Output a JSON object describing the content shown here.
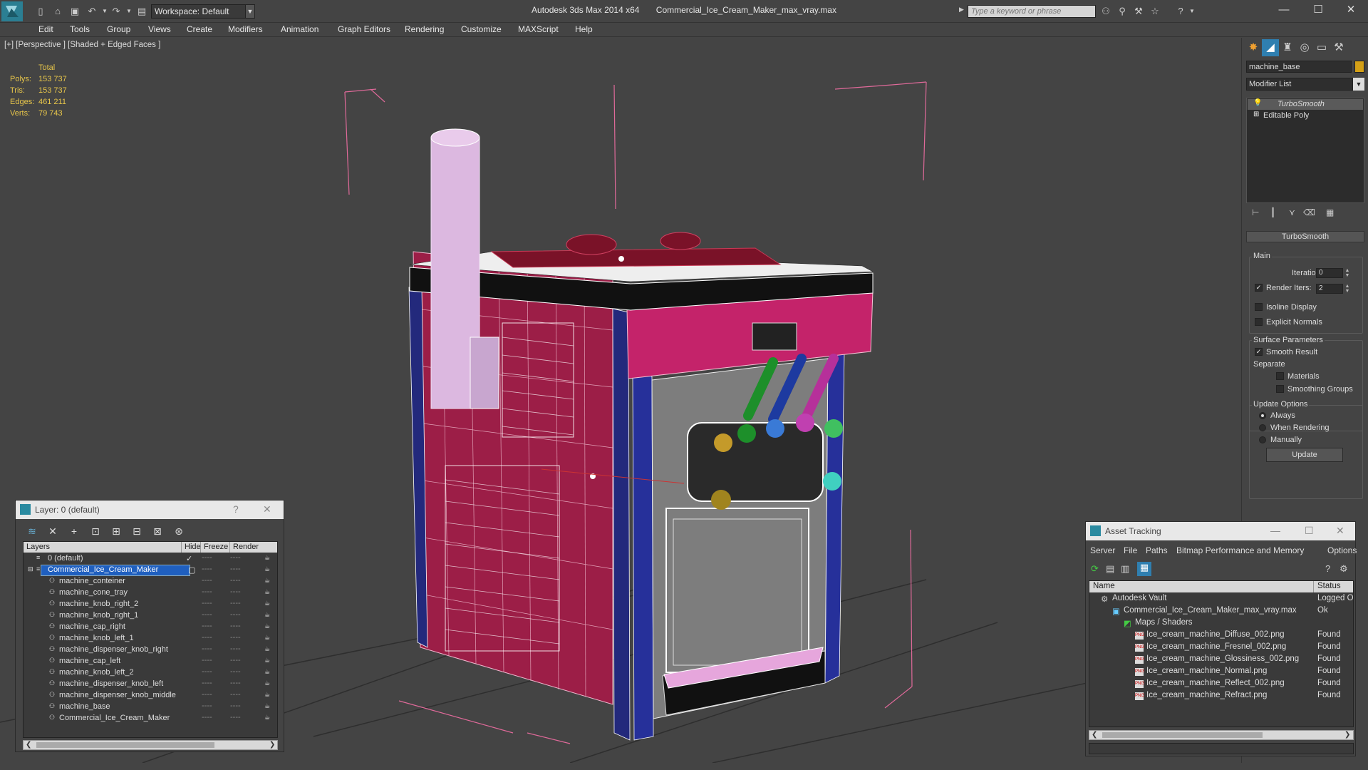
{
  "title": {
    "app": "Autodesk 3ds Max  2014 x64",
    "file": "Commercial_Ice_Cream_Maker_max_vray.max"
  },
  "workspace": "Workspace: Default",
  "search": {
    "placeholder": "Type a keyword or phrase"
  },
  "menu": [
    "Edit",
    "Tools",
    "Group",
    "Views",
    "Create",
    "Modifiers",
    "Animation",
    "Graph Editors",
    "Rendering",
    "Customize",
    "MAXScript",
    "Help"
  ],
  "viewport": {
    "label": "[+] [Perspective ] [Shaded + Edged Faces ]",
    "stats": {
      "header": "Total",
      "polys_label": "Polys:",
      "polys": "153 737",
      "tris_label": "Tris:",
      "tris": "153 737",
      "edges_label": "Edges:",
      "edges": "461 211",
      "verts_label": "Verts:",
      "verts": "79 743"
    }
  },
  "command_panel": {
    "object_name": "machine_base",
    "modifier_list": "Modifier List",
    "stack": [
      "TurboSmooth",
      "Editable Poly"
    ],
    "rollout": "TurboSmooth",
    "main_group": "Main",
    "iterations_label": "Iterations:",
    "iterations": "0",
    "render_iters_label": "Render Iters:",
    "render_iters": "2",
    "isoline": "Isoline Display",
    "explicit_normals": "Explicit Normals",
    "surface_group": "Surface Parameters",
    "smooth_result": "Smooth Result",
    "separate": "Separate",
    "materials": "Materials",
    "smoothing_groups": "Smoothing Groups",
    "update_group": "Update Options",
    "always": "Always",
    "when_rendering": "When Rendering",
    "manually": "Manually",
    "update_btn": "Update",
    "object_color": "#d4a017"
  },
  "layer_window": {
    "title": "Layer: 0 (default)",
    "help": "?",
    "close": "✕",
    "columns": [
      "Layers",
      "Hide",
      "Freeze",
      "Render"
    ],
    "rows": [
      "0 (default)",
      "Commercial_Ice_Cream_Maker",
      "machine_conteiner",
      "machine_cone_tray",
      "machine_knob_right_2",
      "machine_knob_right_1",
      "machine_cap_right",
      "machine_knob_left_1",
      "machine_dispenser_knob_right",
      "machine_cap_left",
      "machine_knob_left_2",
      "machine_dispenser_knob_left",
      "machine_dispenser_knob_middle",
      "machine_base",
      "Commercial_Ice_Cream_Maker"
    ],
    "dash": "----"
  },
  "asset_window": {
    "title": "Asset Tracking",
    "menu": [
      "Server",
      "File",
      "Paths",
      "Bitmap Performance and Memory",
      "Options"
    ],
    "columns": [
      "Name",
      "Status"
    ],
    "rows": [
      {
        "name": "Autodesk Vault",
        "status": "Logged O"
      },
      {
        "name": "Commercial_Ice_Cream_Maker_max_vray.max",
        "status": "Ok"
      },
      {
        "name": "Maps / Shaders",
        "status": ""
      },
      {
        "name": "Ice_cream_machine_Diffuse_002.png",
        "status": "Found"
      },
      {
        "name": "Ice_cream_machine_Fresnel_002.png",
        "status": "Found"
      },
      {
        "name": "Ice_cream_machine_Glossiness_002.png",
        "status": "Found"
      },
      {
        "name": "Ice_cream_machine_Normal.png",
        "status": "Found"
      },
      {
        "name": "Ice_cream_machine_Reflect_002.png",
        "status": "Found"
      },
      {
        "name": "Ice_cream_machine_Refract.png",
        "status": "Found"
      }
    ]
  }
}
